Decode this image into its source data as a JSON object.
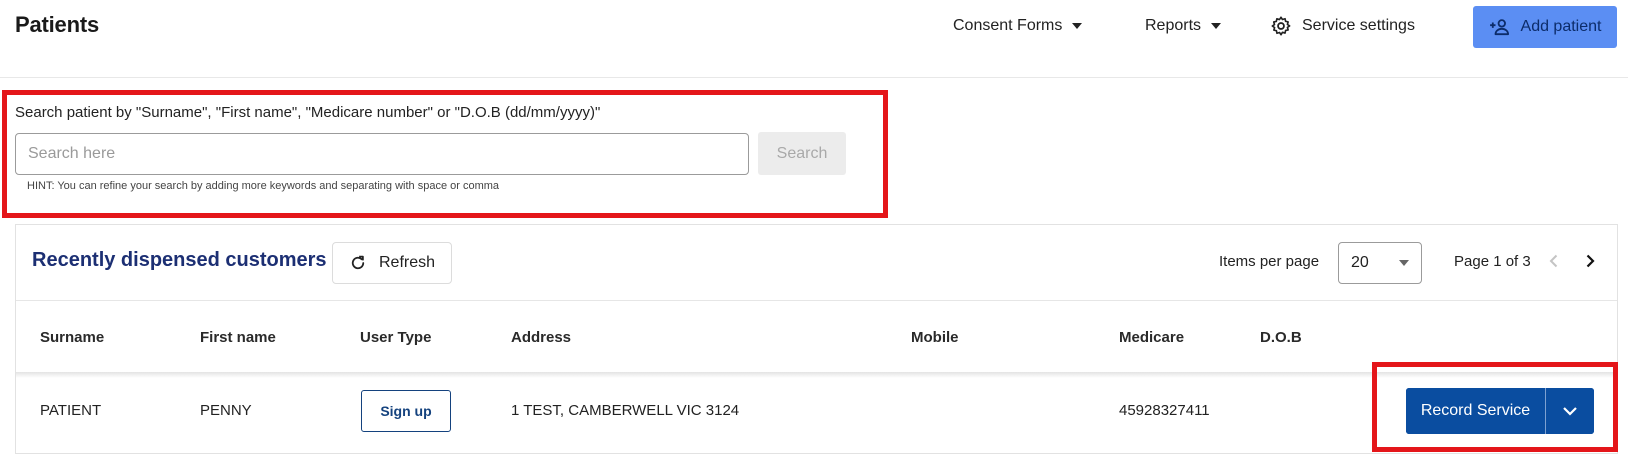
{
  "header": {
    "title": "Patients",
    "nav": {
      "consent_forms": "Consent Forms",
      "reports": "Reports",
      "service_settings": "Service settings"
    },
    "add_patient": "Add patient"
  },
  "search": {
    "label": "Search patient by \"Surname\", \"First name\", \"Medicare number\" or \"D.O.B (dd/mm/yyyy)\"",
    "placeholder": "Search here",
    "value": "",
    "button": "Search",
    "hint": "HINT: You can refine your search by adding more keywords and separating with space or comma"
  },
  "recent": {
    "title": "Recently dispensed customers",
    "refresh": "Refresh",
    "items_per_page_label": "Items per page",
    "items_per_page_value": "20",
    "page_info": "Page 1 of 3",
    "columns": [
      "Surname",
      "First name",
      "User Type",
      "Address",
      "Mobile",
      "Medicare",
      "D.O.B"
    ],
    "rows": [
      {
        "surname": "PATIENT",
        "first_name": "PENNY",
        "user_type_button": "Sign up",
        "address": "1 TEST, CAMBERWELL VIC 3124",
        "mobile": "",
        "medicare": "45928327411",
        "dob": "",
        "action": "Record Service"
      }
    ]
  },
  "colors": {
    "primary": "#0a4da0",
    "add_button": "#5b8ef3",
    "card_title": "#1c2f73",
    "highlight": "#e4161a"
  }
}
